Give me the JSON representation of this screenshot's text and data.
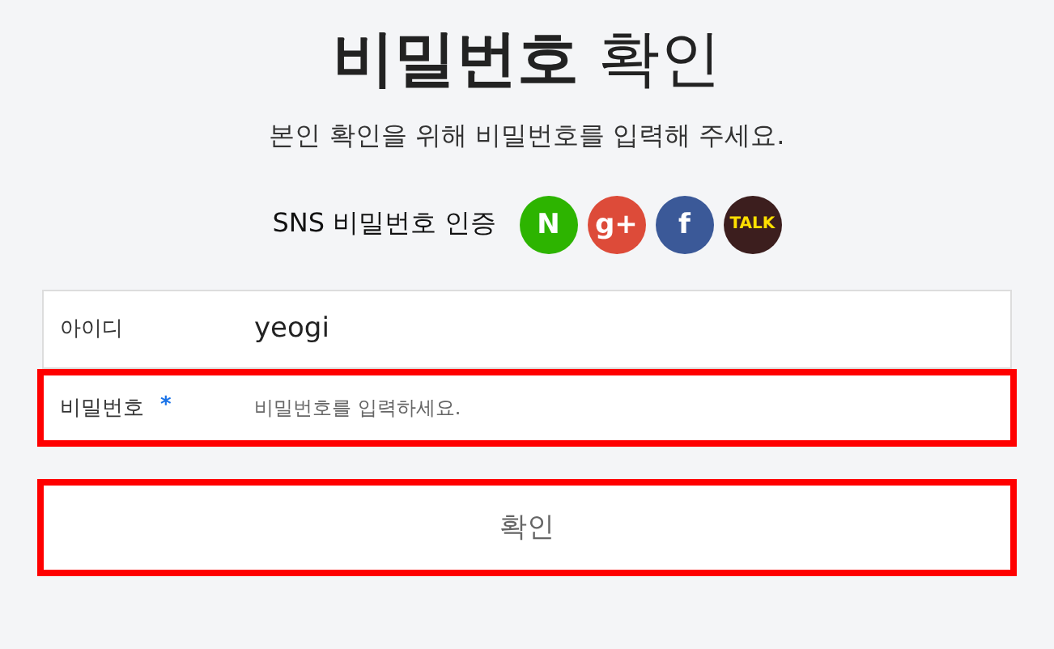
{
  "title": "**비밀번호** 확인",
  "subtitle": "본인 확인을 위해 비밀번호를 입력해 주세요.",
  "sns": {
    "label": "SNS 비밀번호 인증",
    "providers": [
      {
        "label": "N",
        "color": "#2db400"
      },
      {
        "label": "g+",
        "color": "#dd4b39"
      },
      {
        "label": "f",
        "color": "#3b5998"
      },
      {
        "label": "TALK",
        "color": "#3c1e1e"
      }
    ]
  },
  "fields": [
    {
      "label": "아이디",
      "value": "yeogi",
      "highlighted": false
    },
    {
      "label": "비밀번호",
      "placeholder": "비밀번호를 입력하세요.",
      "required_mark": "*",
      "highlighted": true
    }
  ],
  "submit": {
    "label": "확인",
    "highlighted": true
  }
}
